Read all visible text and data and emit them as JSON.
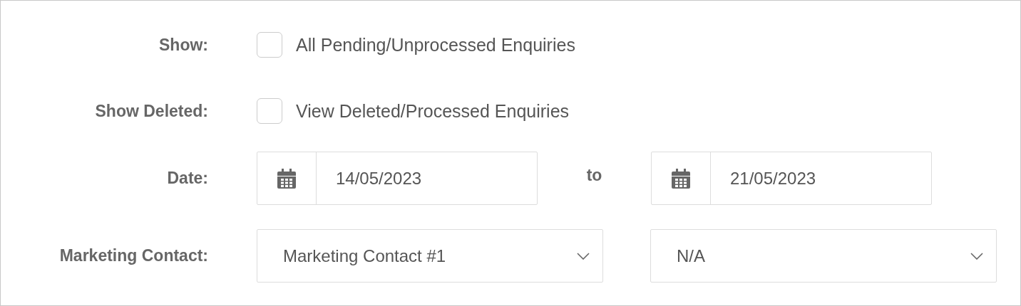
{
  "rows": [
    {
      "kind": "checkbox",
      "label": "Show:",
      "checked": false,
      "text": "All Pending/Unprocessed Enquiries"
    },
    {
      "kind": "checkbox",
      "label": "Show Deleted:",
      "checked": false,
      "text": "View Deleted/Processed Enquiries"
    },
    {
      "kind": "daterange",
      "label": "Date:",
      "from": "14/05/2023",
      "separator": "to",
      "to": "21/05/2023"
    },
    {
      "kind": "selects",
      "label": "Marketing Contact:",
      "values": [
        "Marketing Contact #1",
        "N/A"
      ]
    }
  ]
}
